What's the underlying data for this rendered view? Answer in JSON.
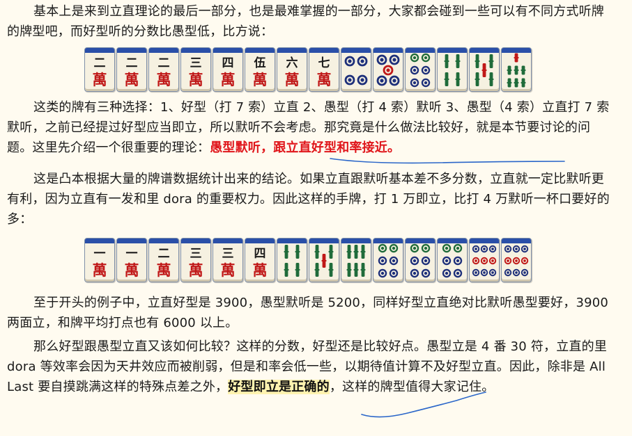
{
  "paragraphs": {
    "p1": "基本上是来到立直理论的最后一部分，也是最难掌握的一部分，大家都会碰到一些可以有不同方式听牌的牌型吧，而好型听的分数比愚型低，比方说：",
    "p2_a": "这类的牌有三种选择：1、好型（打 7 索）立直 2、愚型（打 4 索）默听 3、愚型（4 索）立直打 7 索默听，之前已经提过好型应当即立，所以默听不会考虑。那究竟是什么做法比较好，就是本节要讨论的问题。这里先介绍一个很重要的理论：",
    "p2_highlight": "愚型默听，跟立直好型和率接近。",
    "p3": "这是凸本根据大量的牌谱数据统计出来的结论。如果立直跟默听基本差不多分数，立直就一定比默听更有利，因为立直有一发和里 dora 的重要权力。因此这样的手牌，打 1 万即立，比打 4 万默听一杯口要好的多：",
    "p4": "至于开头的例子中，立直好型是 3900，愚型默听是 5200，同样好型立直绝对比默听愚型要好，3900 两面立，和牌平均打点也有 6000 以上。",
    "p5_a": "那么好型跟愚型立直又该如何比较？这样的分数，好型还是比较好点。愚型立是 4 番 30 符，立直的里 dora 等效率会因为天井效应而被削弱，但是和率会低一些，以期待值计算不及好型立直。因此，除非是 All Last 要自摸跳满这样的特殊点差之外，",
    "p5_highlight": "好型即立是正确的",
    "p5_b": "，这样的牌型值得大家记住。"
  },
  "hands": {
    "hand1": [
      {
        "kind": "man",
        "char": "二"
      },
      {
        "kind": "man",
        "char": "二"
      },
      {
        "kind": "man",
        "char": "二"
      },
      {
        "kind": "man",
        "char": "三"
      },
      {
        "kind": "man",
        "char": "四"
      },
      {
        "kind": "man",
        "char": "伍"
      },
      {
        "kind": "man",
        "char": "六"
      },
      {
        "kind": "man",
        "char": "七"
      },
      {
        "kind": "pin",
        "n": 4
      },
      {
        "kind": "pin",
        "n": 5
      },
      {
        "kind": "pin",
        "n": 6
      },
      {
        "kind": "sou",
        "n": 4
      },
      {
        "kind": "sou",
        "n": 5
      },
      {
        "kind": "sou",
        "n": 7
      }
    ],
    "hand2": [
      {
        "kind": "man",
        "char": "一"
      },
      {
        "kind": "man",
        "char": "一"
      },
      {
        "kind": "man",
        "char": "二"
      },
      {
        "kind": "man",
        "char": "三"
      },
      {
        "kind": "man",
        "char": "三"
      },
      {
        "kind": "man",
        "char": "四"
      },
      {
        "kind": "sou",
        "n": 4
      },
      {
        "kind": "sou",
        "n": 5
      },
      {
        "kind": "sou",
        "n": 6
      },
      {
        "kind": "pin",
        "n": 6
      },
      {
        "kind": "pin",
        "n": 6
      },
      {
        "kind": "pin",
        "n": 6
      },
      {
        "kind": "pin",
        "n": 9
      },
      {
        "kind": "pin",
        "n": 9
      }
    ],
    "man_suffix": "萬"
  },
  "colors": {
    "text": "#1a1a1a",
    "highlight_red": "#e0161b",
    "highlight_yellow": "#fff3b0",
    "pen_blue": "#2a66c9",
    "tile_back": "#2a4fa8",
    "tile_face": "#f6f1e1"
  }
}
